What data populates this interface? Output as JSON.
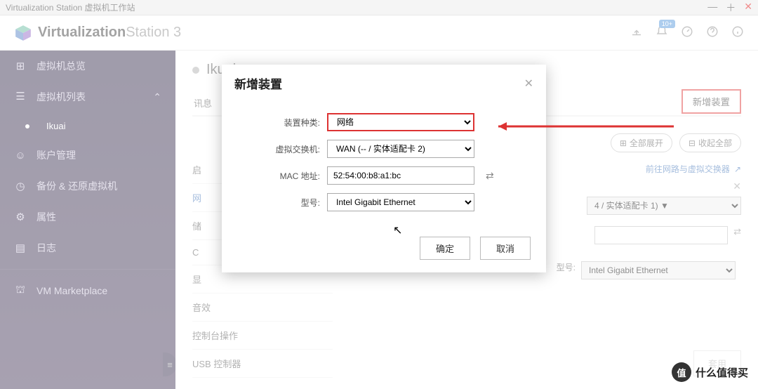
{
  "window": {
    "title": "Virtualization Station 虚拟机工作站"
  },
  "header": {
    "brand_bold": "Virtualization",
    "brand_light": "Station 3",
    "badge": "10+"
  },
  "sidebar": {
    "overview": "虚拟机总览",
    "vmlist": "虚拟机列表",
    "vm_sub": "Ikuai",
    "account": "账户管理",
    "backup": "备份 & 还原虚拟机",
    "props": "属性",
    "logs": "日志",
    "market": "VM Marketplace"
  },
  "page": {
    "title": "Ikuai",
    "tab_info": "讯息"
  },
  "side_sections": {
    "boot": "启",
    "net": "网",
    "store": "储",
    "cd": "C",
    "video": "显",
    "audio": "音效",
    "console": "控制台操作",
    "usb": "USB 控制器"
  },
  "buttons": {
    "add_device": "新增装置",
    "expand_all": "全部展开",
    "collapse_all": "收起全部",
    "apply": "套用",
    "ok": "确定",
    "cancel": "取消"
  },
  "bg": {
    "link": "前往网路与虚拟交换器",
    "sel1": "4 / 实体适配卡 1) ▼",
    "model_label": "型号:",
    "model": "Intel Gigabit Ethernet"
  },
  "modal": {
    "title": "新增装置",
    "labels": {
      "type": "装置种类:",
      "vswitch": "虚拟交换机:",
      "mac": "MAC 地址:",
      "model": "型号:"
    },
    "values": {
      "type": "网络",
      "vswitch": "WAN (-- / 实体适配卡 2)",
      "mac": "52:54:00:b8:a1:bc",
      "model": "Intel Gigabit Ethernet"
    }
  },
  "watermark": {
    "char": "值",
    "text": "什么值得买"
  }
}
